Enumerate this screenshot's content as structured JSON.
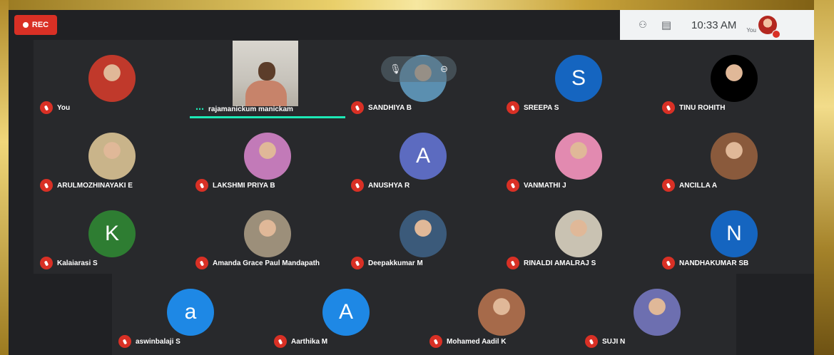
{
  "rec": {
    "label": "REC"
  },
  "topbar": {
    "people_icon": "people-icon",
    "chat_icon": "chat-icon",
    "time": "10:33 AM",
    "you_label": "You"
  },
  "participants": [
    {
      "name": "You",
      "avatar": "photo",
      "color": "#c0392b"
    },
    {
      "name": "rajamanickum manickam",
      "avatar": "video",
      "speaking": true
    },
    {
      "name": "SANDHIYA B",
      "avatar": "photo",
      "color": "#5b8fb0",
      "hover": true
    },
    {
      "name": "SREEPA S",
      "avatar": "letter",
      "letter": "S",
      "color": "#1565c0"
    },
    {
      "name": "TINU ROHITH",
      "avatar": "photo",
      "color": "#000000"
    },
    {
      "name": "ARULMOZHINAYAKI E",
      "avatar": "photo",
      "color": "#c9b48a"
    },
    {
      "name": "LAKSHMI PRIYA B",
      "avatar": "photo",
      "color": "#c27ab8"
    },
    {
      "name": "ANUSHYA R",
      "avatar": "letter",
      "letter": "A",
      "color": "#5c6bc0"
    },
    {
      "name": "VANMATHI J",
      "avatar": "photo",
      "color": "#e28ab0"
    },
    {
      "name": "ANCILLA A",
      "avatar": "photo",
      "color": "#8a5a3c"
    },
    {
      "name": "Kalaiarasi S",
      "avatar": "letter",
      "letter": "K",
      "color": "#2e7d32"
    },
    {
      "name": "Amanda Grace Paul Mandapath",
      "avatar": "photo",
      "color": "#9c8f7a"
    },
    {
      "name": "Deepakkumar M",
      "avatar": "photo",
      "color": "#3b5a7a"
    },
    {
      "name": "RINALDI AMALRAJ S",
      "avatar": "photo",
      "color": "#c9c2b2"
    },
    {
      "name": "NANDHAKUMAR SB",
      "avatar": "letter",
      "letter": "N",
      "color": "#1565c0"
    },
    {
      "name": "aswinbalaji S",
      "avatar": "letter",
      "letter": "a",
      "color": "#1e88e5"
    },
    {
      "name": "Aarthika M",
      "avatar": "letter",
      "letter": "A",
      "color": "#1e88e5"
    },
    {
      "name": "Mohamed Aadil K",
      "avatar": "photo",
      "color": "#a66a4a"
    },
    {
      "name": "SUJI N",
      "avatar": "photo",
      "color": "#6d6fb0"
    }
  ]
}
